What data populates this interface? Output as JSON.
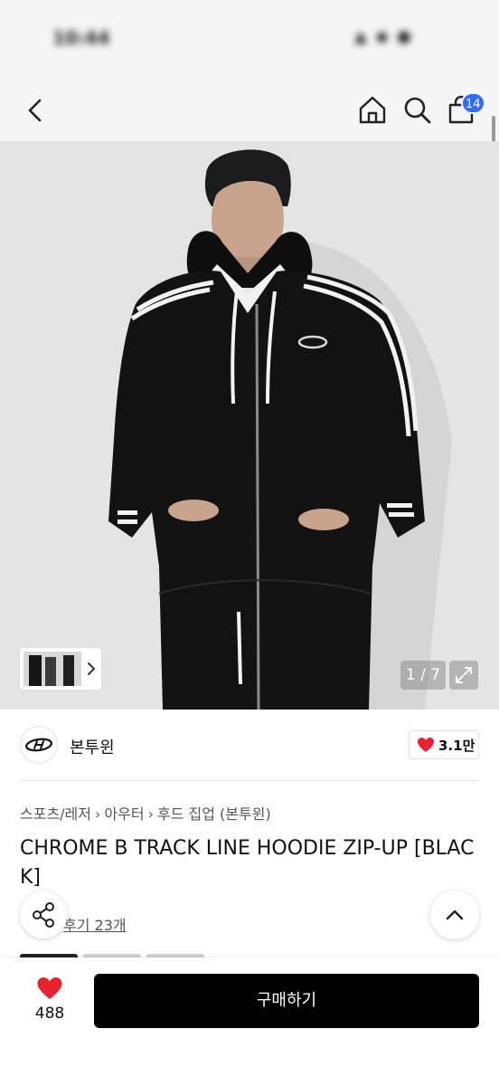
{
  "status_bar": {
    "time": "10:44",
    "icons": "▲ ◆ ●"
  },
  "header": {
    "cart_count": "14"
  },
  "gallery": {
    "counter": "1 / 7"
  },
  "brand": {
    "name": "본투윈",
    "likes": "3.1만"
  },
  "breadcrumb": [
    "스포츠/레저",
    "아우터",
    "후드 집업 (본투윈)"
  ],
  "product": {
    "title": "CHROME B TRACK LINE HOODIE ZIP-UP [BLACK]"
  },
  "review": {
    "label": "후기 23개"
  },
  "bottom_bar": {
    "wish_count": "488",
    "buy_label": "구매하기"
  },
  "colors": {
    "accent": "#2f6bff",
    "heart": "#e8222e",
    "buy_bg": "#000000"
  }
}
